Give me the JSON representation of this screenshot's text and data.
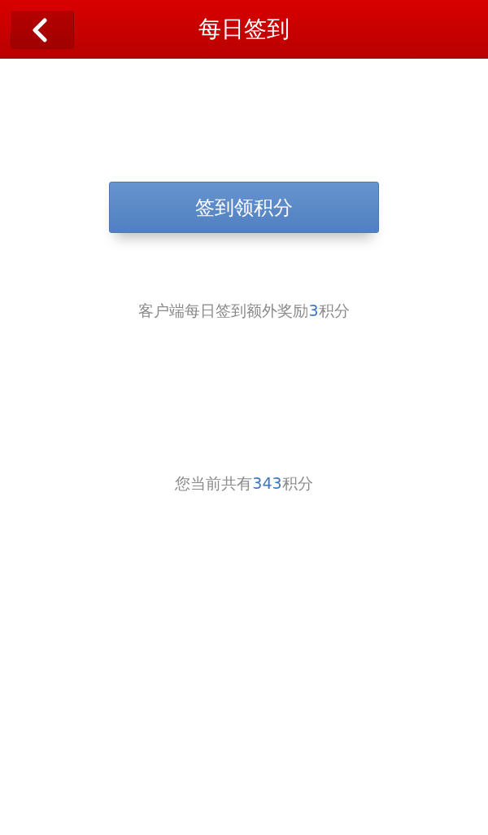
{
  "header": {
    "title": "每日签到"
  },
  "checkin_button": {
    "label": "签到领积分"
  },
  "bonus_note": {
    "before": "客户端每日签到额外奖励",
    "highlight": "3",
    "after": "积分"
  },
  "points_note": {
    "before": "您当前共有",
    "highlight": "343",
    "after": "积分"
  }
}
